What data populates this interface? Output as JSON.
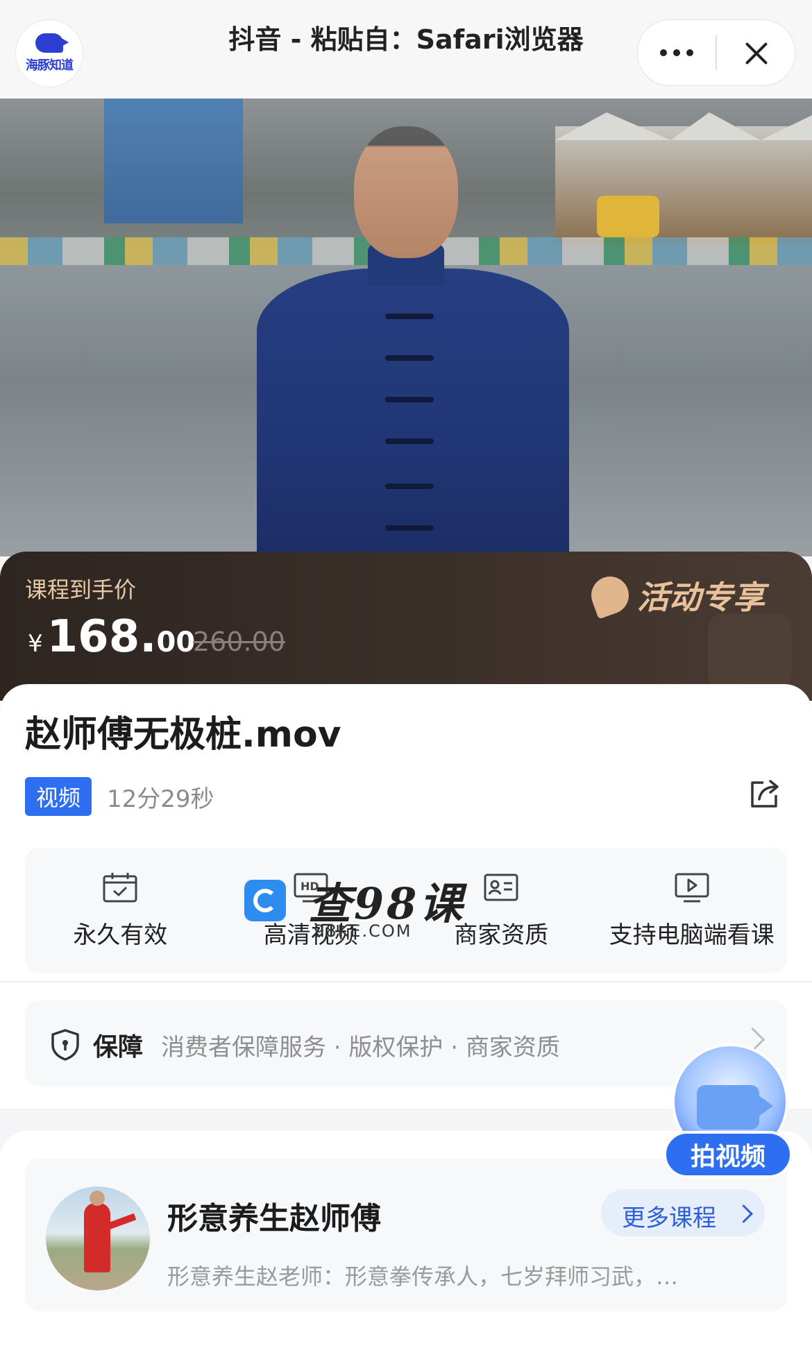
{
  "topbar": {
    "logo_text": "海豚知道",
    "title": "抖音 - 粘贴自：Safari浏览器"
  },
  "price": {
    "label": "课程到手价",
    "currency": "¥",
    "current_int": "168.",
    "current_dec": "00",
    "original": "260.00",
    "promo": "活动专享"
  },
  "course": {
    "title": "赵师傅无极桩.mov",
    "type_badge": "视频",
    "duration": "12分29秒"
  },
  "features": [
    {
      "label": "永久有效",
      "icon": "calendar-check-icon"
    },
    {
      "label": "高清视频",
      "icon": "hd-video-icon"
    },
    {
      "label": "商家资质",
      "icon": "id-card-icon"
    },
    {
      "label": "支持电脑端看课",
      "icon": "monitor-play-icon"
    }
  ],
  "guarantee": {
    "title": "保障",
    "items": "消费者保障服务 · 版权保护 · 商家资质"
  },
  "teacher": {
    "name": "形意养生赵师傅",
    "more_label": "更多课程",
    "description": "形意养生赵老师：形意拳传承人，七岁拜师习武，…"
  },
  "float_button": {
    "label": "拍视频"
  },
  "watermark": {
    "text": "查98课",
    "sub": "98KE.COM"
  },
  "colors": {
    "accent": "#2d6ff0",
    "price_banner": "#3b2f29",
    "promo_gold": "#e9c29b"
  }
}
